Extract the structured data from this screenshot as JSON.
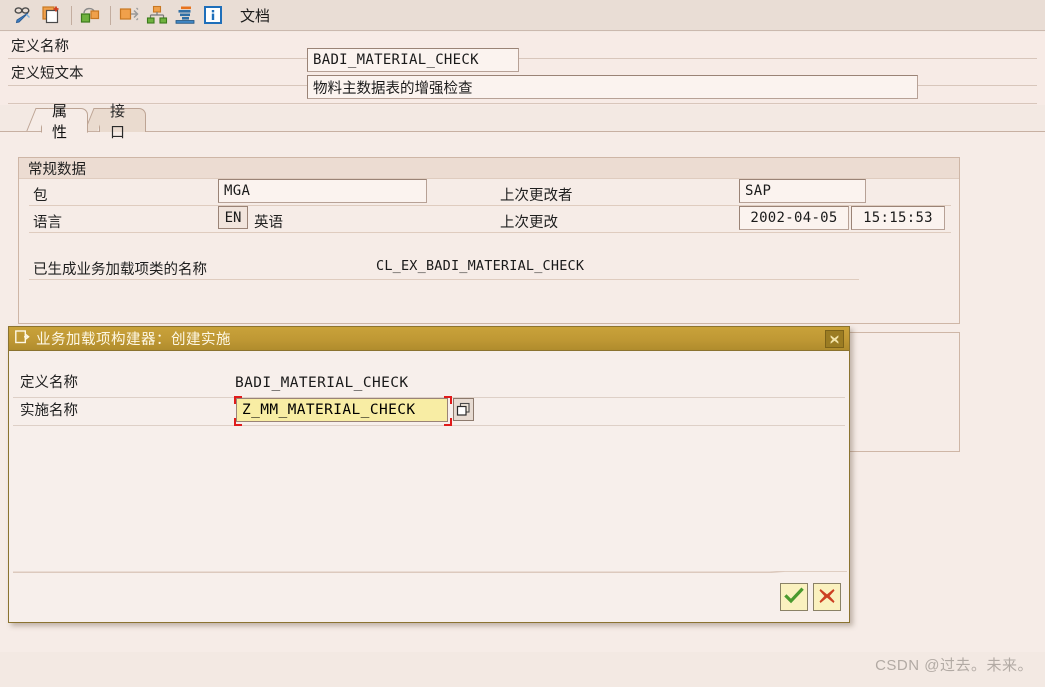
{
  "toolbar": {
    "icons": [
      {
        "name": "display-change-icon",
        "title": "显示 <-> 更改"
      },
      {
        "name": "create-copy-icon",
        "title": "创建"
      },
      {
        "name": "interface-icon",
        "title": "接口"
      },
      {
        "name": "where-used-icon",
        "title": "使用位置"
      },
      {
        "name": "hierarchy-icon",
        "title": "层次"
      },
      {
        "name": "sort-icon",
        "title": "排序"
      },
      {
        "name": "info-icon",
        "title": "信息"
      }
    ],
    "doc_label": "文档"
  },
  "header": {
    "rows": [
      {
        "label": "定义名称",
        "value": "BADI_MATERIAL_CHECK"
      },
      {
        "label": "定义短文本",
        "value": "物料主数据表的增强检查"
      }
    ]
  },
  "tabs": [
    {
      "label": "属性",
      "active": true
    },
    {
      "label": "接口",
      "active": false
    }
  ],
  "general_group": {
    "title": "常规数据",
    "package_label": "包",
    "package_value": "MGA",
    "language_label": "语言",
    "language_code": "EN",
    "language_name": "英语",
    "last_changed_by_label": "上次更改者",
    "last_changed_by_value": "SAP",
    "last_changed_label": "上次更改",
    "last_changed_date": "2002-04-05",
    "last_changed_time": "15:15:53",
    "generated_class_label": "已生成业务加载项类的名称",
    "generated_class_value": "CL_EX_BADI_MATERIAL_CHECK"
  },
  "dialog": {
    "title": "业务加载项构建器：创建实施",
    "title_icon": "dialog-window-icon",
    "close_icon": "close-icon",
    "definition_label": "定义名称",
    "definition_value": "BADI_MATERIAL_CHECK",
    "implementation_label": "实施名称",
    "implementation_value": "Z_MM_MATERIAL_CHECK",
    "multi_select_icon": "multi-select-icon",
    "confirm_icon": "check-icon",
    "cancel_icon": "cancel-x-icon"
  },
  "watermark": "CSDN @过去。未来。",
  "colors": {
    "background": "#f3e9e3",
    "panel": "#f6ece7",
    "dialog_title": "#bf9834",
    "focus_field": "#f8eda4",
    "focus_corner": "#e01b1b",
    "confirm_green": "#4a9a2e",
    "cancel_red": "#cc3f22"
  }
}
